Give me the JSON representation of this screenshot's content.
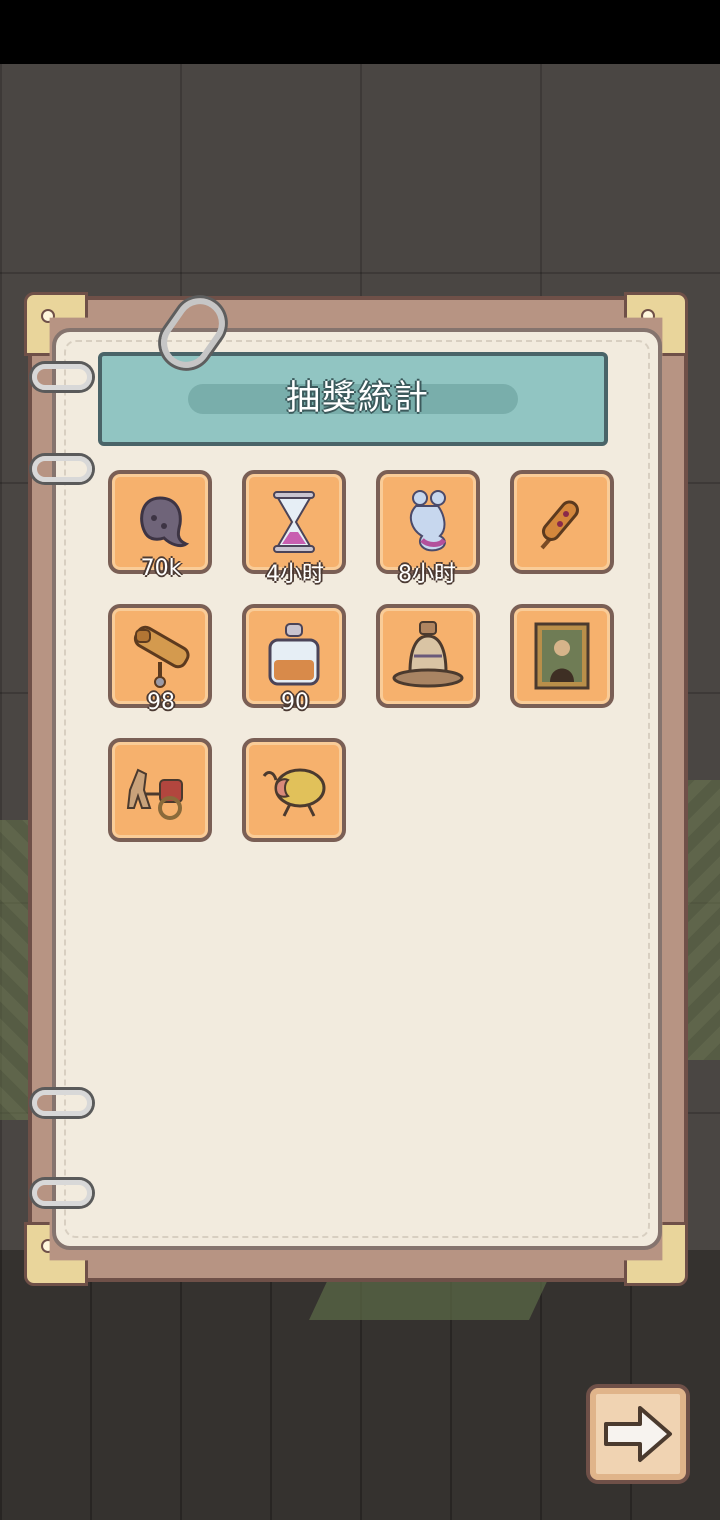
{
  "panel": {
    "title": "抽獎統計"
  },
  "items": [
    {
      "icon": "ghost-blob-icon",
      "count": "70k"
    },
    {
      "icon": "hourglass-icon",
      "count": "4小时"
    },
    {
      "icon": "ghost-spirit-icon",
      "count": "8小时"
    },
    {
      "icon": "firework-rocket-icon",
      "count": ""
    },
    {
      "icon": "telescope-icon",
      "count": "98"
    },
    {
      "icon": "perfume-bottle-icon",
      "count": "90"
    },
    {
      "icon": "bell-icon",
      "count": ""
    },
    {
      "icon": "mona-lisa-painting-icon",
      "count": ""
    },
    {
      "icon": "horse-chariot-icon",
      "count": ""
    },
    {
      "icon": "scarab-beetle-icon",
      "count": ""
    }
  ],
  "navigation": {
    "next_icon": "arrow-right-icon"
  }
}
